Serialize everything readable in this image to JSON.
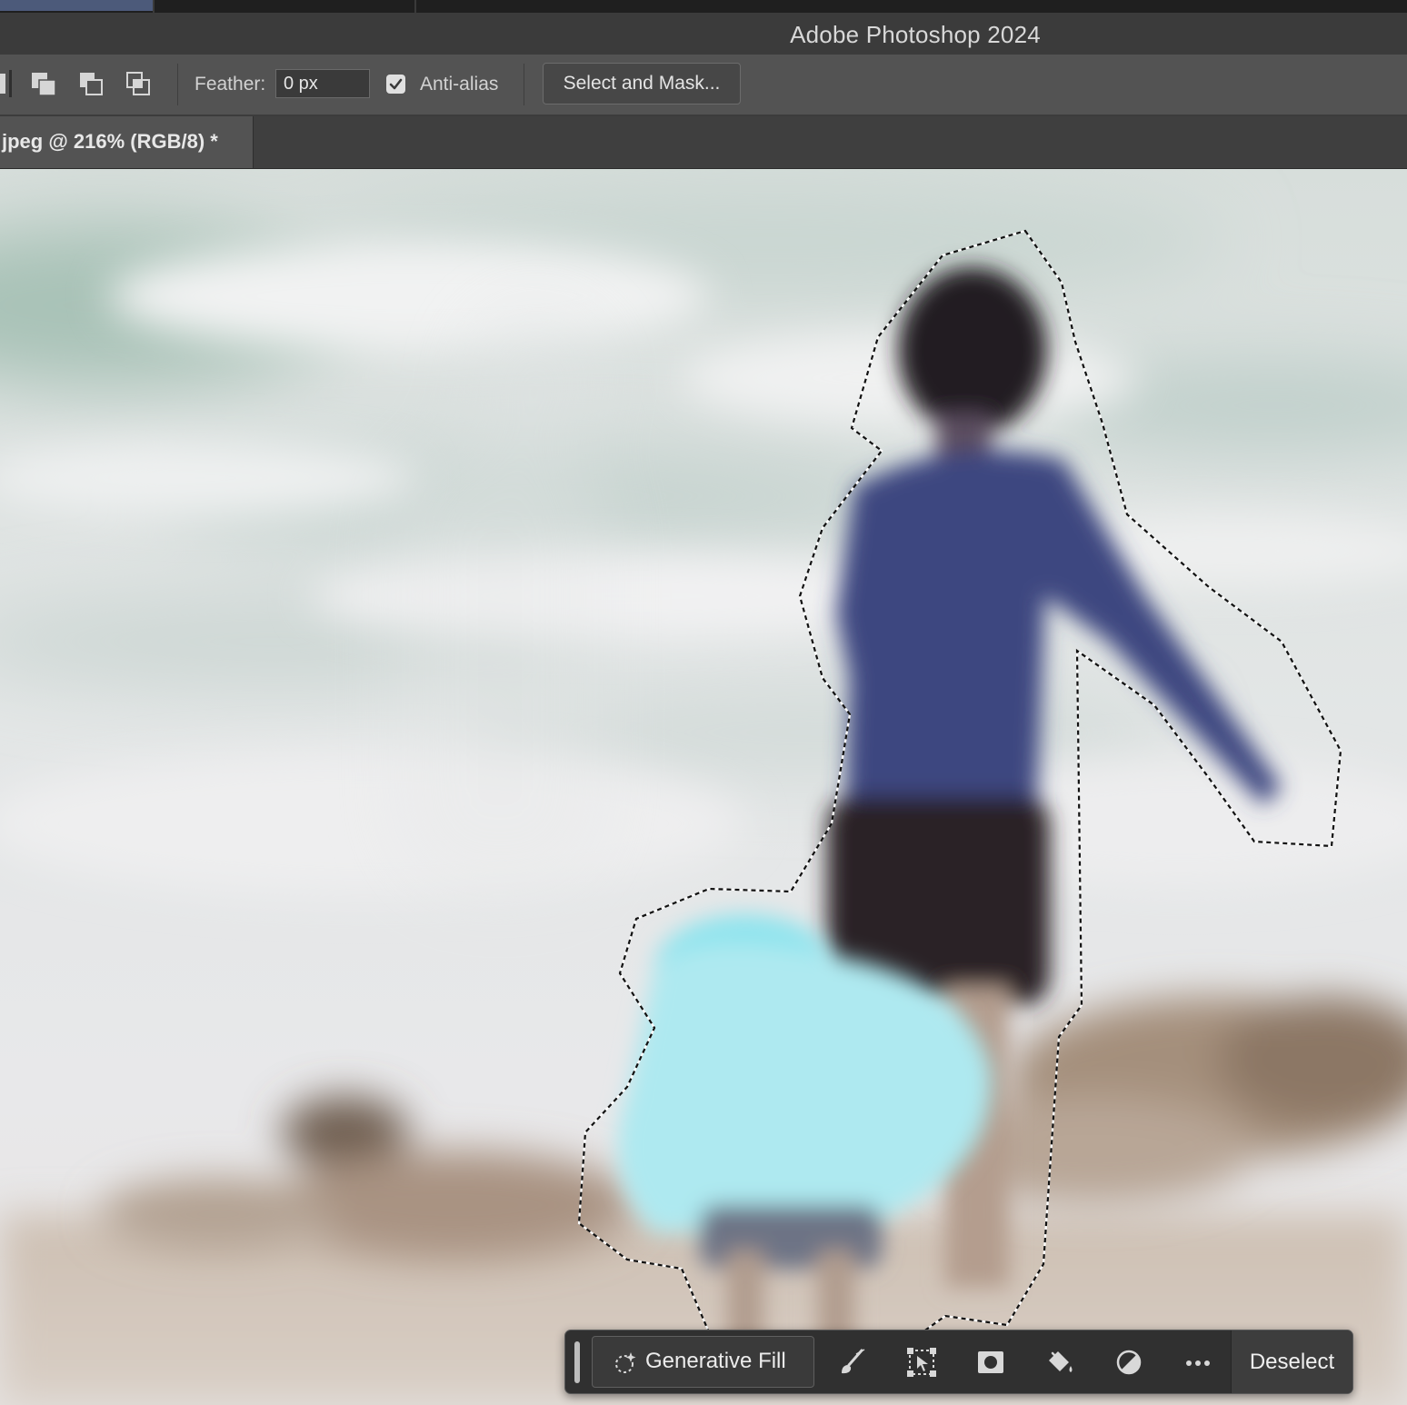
{
  "app": {
    "title": "Adobe Photoshop 2024"
  },
  "options_bar": {
    "feather_label": "Feather:",
    "feather_value": "0 px",
    "anti_alias_label": "Anti-alias",
    "anti_alias_checked": true,
    "select_and_mask_label": "Select and Mask..."
  },
  "document": {
    "tab_label": "jpeg @ 216% (RGB/8) *"
  },
  "contextual_taskbar": {
    "generative_fill_label": "Generative Fill",
    "deselect_label": "Deselect",
    "icons": [
      "generative-fill-icon",
      "brush-icon",
      "transform-selection-icon",
      "mask-icon",
      "fill-bucket-icon",
      "adjustment-icon",
      "more-icon"
    ]
  },
  "colors": {
    "accent": "#e0e0e0",
    "panel": "#535353",
    "taskbar": "#303030"
  }
}
